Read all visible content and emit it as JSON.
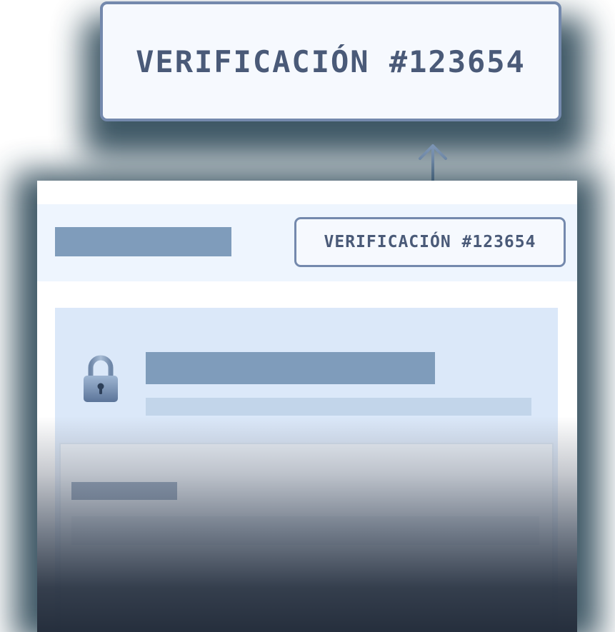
{
  "callout": {
    "text": "VERIFICACIÓN #123654"
  },
  "card": {
    "badge_text": "VERIFICACIÓN #123654",
    "header_icon": "arrow-up-icon",
    "lock_icon": "lock-icon"
  },
  "colors": {
    "accent": "#7489ad",
    "text": "#4a5a78",
    "placeholder_dark": "#7f9cbb",
    "placeholder_light": "#c2d5ea",
    "panel": "#dbe8f9",
    "header_bg": "#eef5fe"
  }
}
